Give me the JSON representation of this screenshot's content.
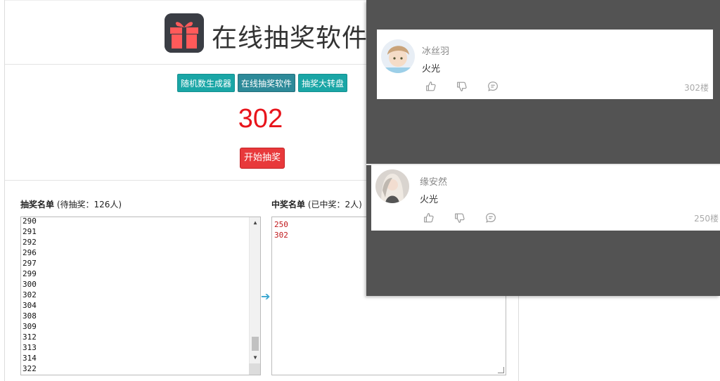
{
  "header": {
    "title": "在线抽奖软件",
    "logo_icon": "gift-icon"
  },
  "nav": {
    "items": [
      {
        "label": "随机数生成器",
        "active": false
      },
      {
        "label": "在线抽奖软件",
        "active": true
      },
      {
        "label": "抽奖大转盘",
        "active": false
      }
    ]
  },
  "result": {
    "number": "302",
    "start_label": "开始抽奖",
    "color": "#e8141b"
  },
  "pending_list": {
    "title": "抽奖名单",
    "subtitle": "(待抽奖：126人)",
    "items": [
      "290",
      "291",
      "292",
      "296",
      "297",
      "299",
      "300",
      "302",
      "304",
      "308",
      "309",
      "312",
      "313",
      "314",
      "322"
    ]
  },
  "winner_list": {
    "title": "中奖名单",
    "subtitle": "(已中奖：2人)",
    "items": [
      "250",
      "302"
    ]
  },
  "transfer_icon": "arrow-right-icon",
  "comments": [
    {
      "username": "冰丝羽",
      "content": "火光",
      "floor": "302楼",
      "avatar_icon": "avatar-icon"
    },
    {
      "username": "缘安然",
      "content": "火光",
      "floor": "250楼",
      "avatar_icon": "avatar-icon"
    }
  ],
  "colors": {
    "nav_button": "#1aa6a6",
    "nav_active": "#2d8a99",
    "start_button": "#e8393b",
    "overlay": "#535353",
    "winner_text": "#c0191c"
  }
}
